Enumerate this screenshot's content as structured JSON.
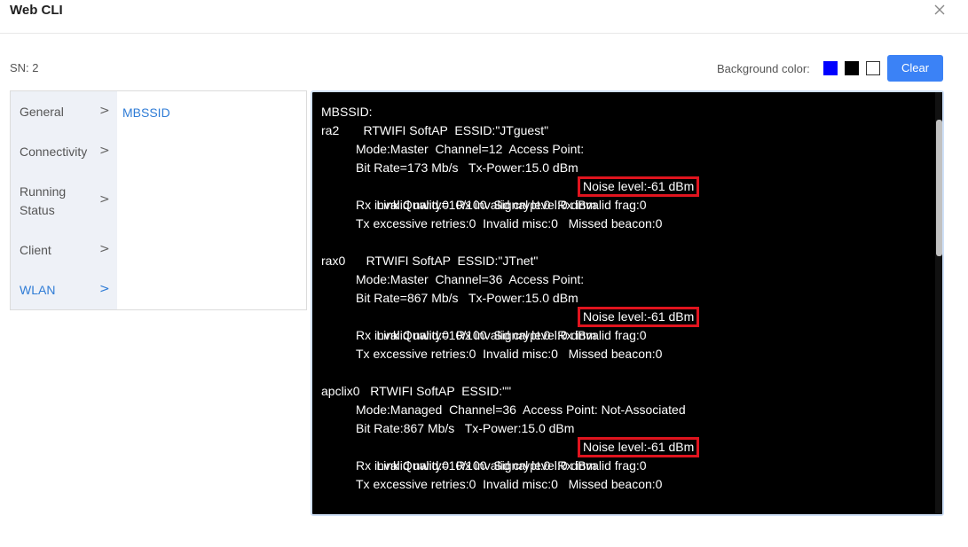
{
  "window": {
    "title": "Web CLI"
  },
  "sn": {
    "label": "SN: 2"
  },
  "background_color": {
    "label": "Background color:",
    "swatches": [
      "#0000ff",
      "#000000",
      "#ffffff"
    ]
  },
  "toolbar": {
    "clear_label": "Clear"
  },
  "sidebar": {
    "items": [
      {
        "label": "General"
      },
      {
        "label": "Connectivity"
      },
      {
        "label": "Running Status"
      },
      {
        "label": "Client"
      },
      {
        "label": "WLAN"
      }
    ],
    "active": "WLAN",
    "sub_item": "MBSSID"
  },
  "terminal": {
    "heading": "MBSSID:",
    "interfaces": [
      {
        "header": "ra2       RTWIFI SoftAP  ESSID:\"JTguest\"",
        "mode": "Mode:Master  Channel=12  Access Point:",
        "bitrate": "Bit Rate=173 Mb/s   Tx-Power:15.0 dBm",
        "link": "Link Quality=10/100  Signal level:0 dBm",
        "noise": "Noise level:-61 dBm",
        "rx": "Rx invalid nwid:0  Rx invalid crypt:0  Rx invalid frag:0",
        "tx": "Tx excessive retries:0  Invalid misc:0   Missed beacon:0"
      },
      {
        "header": "rax0      RTWIFI SoftAP  ESSID:\"JTnet\"",
        "mode": "Mode:Master  Channel=36  Access Point:",
        "bitrate": "Bit Rate=867 Mb/s   Tx-Power:15.0 dBm",
        "link": "Link Quality=10/100  Signal level:0 dBm",
        "noise": "Noise level:-61 dBm",
        "rx": "Rx invalid nwid:0  Rx invalid crypt:0  Rx invalid frag:0",
        "tx": "Tx excessive retries:0  Invalid misc:0   Missed beacon:0"
      },
      {
        "header": "apclix0   RTWIFI SoftAP  ESSID:\"\"",
        "mode": "Mode:Managed  Channel=36  Access Point: Not-Associated",
        "bitrate": "Bit Rate:867 Mb/s   Tx-Power:15.0 dBm",
        "link": "Link Quality=10/100  Signal level:0 dBm",
        "noise": "Noise level:-61 dBm",
        "rx": "Rx invalid nwid:0  Rx invalid crypt:0  Rx invalid frag:0",
        "tx": "Tx excessive retries:0  Invalid misc:0   Missed beacon:0"
      }
    ]
  },
  "icons": {
    "close": "close-icon",
    "chevron": "chevron-right-icon"
  }
}
